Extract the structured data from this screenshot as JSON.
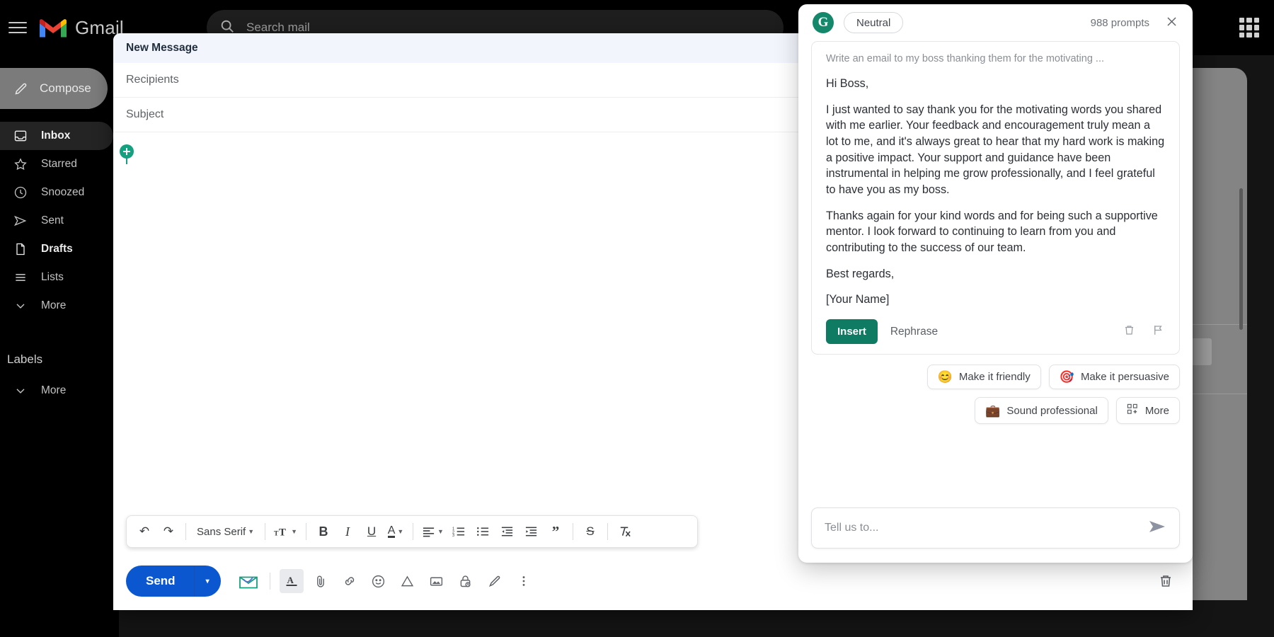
{
  "gmail": {
    "brand": "Gmail",
    "search": {
      "placeholder": "Search mail",
      "icon": "search-icon"
    },
    "menu_icon": "hamburger-menu-icon",
    "apps_icon": "apps-grid-icon",
    "compose_label": "Compose",
    "nav_items": [
      {
        "label": "Inbox",
        "icon": "inbox-icon",
        "active": true
      },
      {
        "label": "Starred",
        "icon": "star-icon",
        "active": false
      },
      {
        "label": "Snoozed",
        "icon": "clock-icon",
        "active": false
      },
      {
        "label": "Sent",
        "icon": "send-icon",
        "active": false
      },
      {
        "label": "Drafts",
        "icon": "file-icon",
        "active": false
      },
      {
        "label": "Lists",
        "icon": "list-icon",
        "active": false
      },
      {
        "label": "More",
        "icon": "chevron-down-icon",
        "active": false
      }
    ],
    "labels_section": "Labels",
    "labels_more": "More",
    "thread_prev": "‹",
    "thread_next": "›"
  },
  "compose": {
    "title": "New Message",
    "recipients_placeholder": "Recipients",
    "subject_placeholder": "Subject",
    "recipients_value": "",
    "subject_value": "",
    "body_value": "",
    "pin_icon": "grammarly-insert-pin-icon",
    "toolbar": {
      "undo": "↶",
      "redo": "↷",
      "font_family": "Sans Serif",
      "font_size_icon": "font-size-icon",
      "bold": "B",
      "italic": "I",
      "underline": "U",
      "text_color": "A",
      "align_icon": "align-left-icon",
      "numbered_list_icon": "numbered-list-icon",
      "bulleted_list_icon": "bulleted-list-icon",
      "indent_less_icon": "indent-decrease-icon",
      "indent_more_icon": "indent-increase-icon",
      "quote": "”",
      "strikethrough": "S",
      "remove_format_icon": "remove-formatting-icon"
    },
    "send_label": "Send",
    "send_caret": "▾",
    "bottom_icons": [
      "grammarly-envelope-icon",
      "format-text-icon",
      "attach-file-icon",
      "insert-link-icon",
      "insert-emoji-icon",
      "insert-drive-icon",
      "insert-photo-icon",
      "confidential-mode-icon",
      "signature-pen-icon",
      "more-options-icon"
    ],
    "discard_icon": "trash-icon"
  },
  "grammarly": {
    "logo": "grammarly-logo-icon",
    "tone": "Neutral",
    "prompts_count": "988 prompts",
    "close_icon": "close-icon",
    "prompt_echo": "Write an email to my boss thanking them for the motivating ...",
    "generated": [
      "Hi Boss,",
      "I just wanted to say thank you for the motivating words you shared with me earlier. Your feedback and encouragement truly mean a lot to me, and it's always great to hear that my hard work is making a positive impact. Your support and guidance have been instrumental in helping me grow professionally, and I feel grateful to have you as my boss.",
      "Thanks again for your kind words and for being such a supportive mentor. I look forward to continuing to learn from you and contributing to the success of our team.",
      "Best regards,",
      "[Your Name]"
    ],
    "insert_label": "Insert",
    "rephrase_label": "Rephrase",
    "delete_icon": "trash-icon",
    "flag_icon": "flag-icon",
    "suggestions_row1": [
      {
        "label": "Make it friendly",
        "glyph": "😊",
        "icon": "smiley-face-icon"
      },
      {
        "label": "Make it persuasive",
        "glyph": "🎯",
        "icon": "target-icon"
      }
    ],
    "suggestions_row2": [
      {
        "label": "Sound professional",
        "glyph": "💼",
        "icon": "briefcase-icon"
      },
      {
        "label": "More",
        "glyph": "□□",
        "icon": "more-grid-icon"
      }
    ],
    "input_placeholder": "Tell us to...",
    "input_value": "",
    "send_icon": "send-arrow-icon"
  },
  "colors": {
    "grammarly_green": "#15886b",
    "insert_green": "#0f7b62",
    "gmail_blue": "#0b57d0",
    "header_bg": "#f2f6fc"
  }
}
